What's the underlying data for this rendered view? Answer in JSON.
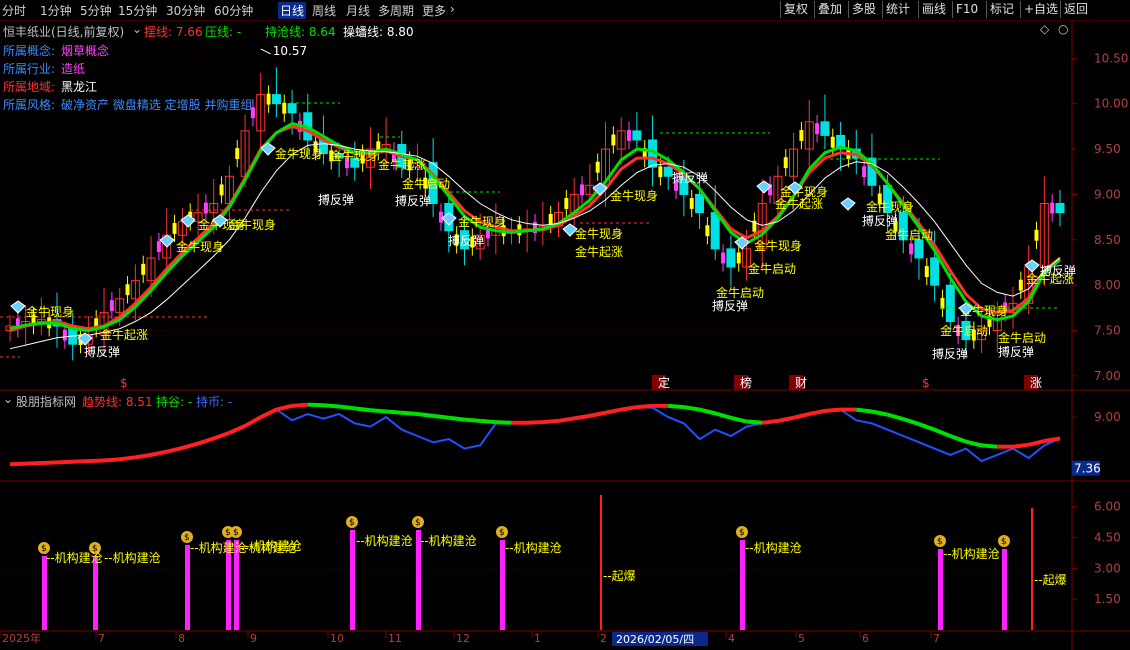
{
  "toolbar": {
    "periods": [
      "分时",
      "1分钟",
      "5分钟",
      "15分钟",
      "30分钟",
      "60分钟",
      "日线",
      "周线",
      "月线",
      "多周期",
      "更多"
    ],
    "active_period": "日线",
    "right_buttons": [
      "复权",
      "叠加",
      "多股",
      "统计",
      "画线",
      "F10",
      "标记",
      "+自选",
      "返回"
    ]
  },
  "main_panel": {
    "stock_title": "恒丰纸业(日线,前复权)",
    "ind_legend": [
      {
        "label": "摆线: 7.66",
        "color": "#ff3030"
      },
      {
        "label": "压线: -",
        "color": "#00e000"
      },
      {
        "label": "持沧线: 8.64",
        "color": "#00e000"
      },
      {
        "label": "操蟠线: 8.80",
        "color": "#ffffff"
      }
    ],
    "info": [
      {
        "key": "所属概念:",
        "value": "烟草概念",
        "key_color": "#3a8aff",
        "value_color": "#ff40ff"
      },
      {
        "key": "所属行业:",
        "value": "造纸",
        "key_color": "#3a8aff",
        "value_color": "#ff40ff"
      },
      {
        "key": "所属地域:",
        "value": "黑龙江",
        "key_color": "#ff3030",
        "value_color": "#ffffff"
      },
      {
        "key": "所属风格:",
        "value": "破净资产 微盘精选 定增股 并购重组",
        "key_color": "#3a8aff",
        "value_color": "#3a8aff"
      }
    ],
    "high_label": "10.57",
    "markers": [
      "$",
      "定",
      "榜",
      "财",
      "$",
      "涨"
    ],
    "signal_labels": [
      "金牛现身",
      "金牛起涨",
      "搏反弹",
      "金牛现身",
      "金牛现身",
      "金牛现身",
      "金牛现身",
      "金牛现身",
      "搏反弹",
      "金牛起涨",
      "金牛启动",
      "搏反弹",
      "金牛现身",
      "搏反弹",
      "金牛现身",
      "金牛起涨",
      "金牛现身",
      "搏反弹",
      "金牛启动",
      "金牛现身",
      "金牛启动",
      "搏反弹",
      "金牛现身",
      "金牛起涨",
      "金牛现身",
      "金牛启动",
      "搏反弹",
      "金牛启动",
      "搏反弹",
      "金牛现身",
      "金牛启动",
      "搏反弹",
      "金牛起涨",
      "搏反弹"
    ]
  },
  "sub_panel1": {
    "title": "股朋指标网",
    "legend": [
      {
        "label": "趋势线: 8.51",
        "color": "#ff3030"
      },
      {
        "label": "持谷: -",
        "color": "#00e000"
      },
      {
        "label": "持币: -",
        "color": "#3a6aff"
      }
    ],
    "current_value": "7.36"
  },
  "sub_panel2": {
    "labels": [
      "机构建沧",
      "机构建沧",
      "机构建沧",
      "机构建沧",
      "机构建沧",
      "机构建沧",
      "机构建沧",
      "机构建沧",
      "机构建沧",
      "机构建沧",
      "起爆",
      "起爆"
    ]
  },
  "chart_data": [
    {
      "type": "candlestick",
      "title": "恒丰纸业(日线,前复权)",
      "ylim": [
        6.9,
        10.9
      ],
      "yticks": [
        "10.50",
        "10.00",
        "9.50",
        "9.00",
        "8.50",
        "8.00",
        "7.50",
        "7.00"
      ],
      "ytick_values": [
        10.5,
        10.0,
        9.5,
        9.0,
        8.5,
        8.0,
        7.5,
        7.0
      ],
      "close": [
        7.55,
        7.6,
        7.62,
        7.55,
        7.35,
        7.45,
        7.7,
        7.85,
        8.05,
        8.3,
        8.55,
        8.7,
        8.8,
        8.9,
        9.2,
        9.7,
        10.1,
        10.0,
        9.9,
        9.6,
        9.45,
        9.4,
        9.3,
        9.5,
        9.55,
        9.3,
        9.35,
        8.9,
        8.6,
        8.4,
        8.55,
        8.6,
        8.6,
        8.62,
        8.65,
        8.8,
        9.0,
        9.1,
        9.5,
        9.7,
        9.6,
        9.3,
        9.2,
        9.0,
        8.8,
        8.4,
        8.2,
        8.4,
        8.9,
        9.2,
        9.5,
        9.8,
        9.65,
        9.5,
        9.4,
        9.1,
        8.8,
        8.5,
        8.3,
        8.0,
        7.6,
        7.4,
        7.5,
        7.7,
        7.8,
        8.2,
        8.9,
        8.8
      ],
      "series": [
        {
          "name": "摆线",
          "color": "#ff3030",
          "values": [
            7.5,
            7.55,
            7.58,
            7.6,
            7.55,
            7.52,
            7.55,
            7.65,
            7.8,
            7.98,
            8.18,
            8.36,
            8.52,
            8.68,
            8.88,
            9.18,
            9.5,
            9.68,
            9.75,
            9.7,
            9.6,
            9.52,
            9.45,
            9.45,
            9.48,
            9.42,
            9.38,
            9.22,
            9.02,
            8.82,
            8.7,
            8.64,
            8.6,
            8.6,
            8.61,
            8.66,
            8.76,
            8.88,
            9.06,
            9.28,
            9.4,
            9.4,
            9.34,
            9.22,
            9.06,
            8.84,
            8.62,
            8.52,
            8.6,
            8.76,
            8.98,
            9.24,
            9.4,
            9.46,
            9.44,
            9.32,
            9.12,
            8.9,
            8.68,
            8.44,
            8.16,
            7.9,
            7.74,
            7.7,
            7.72,
            7.86,
            8.16,
            8.3
          ]
        },
        {
          "name": "持沧线",
          "color": "#00e000",
          "values": [
            7.52,
            7.56,
            7.58,
            7.58,
            7.52,
            7.5,
            7.54,
            7.62,
            7.76,
            7.94,
            8.14,
            8.32,
            8.48,
            8.64,
            8.86,
            9.16,
            9.48,
            9.68,
            9.78,
            9.74,
            9.64,
            9.54,
            9.46,
            9.46,
            9.5,
            9.44,
            9.38,
            9.2,
            8.98,
            8.76,
            8.64,
            8.6,
            8.58,
            8.6,
            8.62,
            8.68,
            8.8,
            8.94,
            9.14,
            9.38,
            9.5,
            9.48,
            9.38,
            9.24,
            9.06,
            8.82,
            8.58,
            8.46,
            8.56,
            8.74,
            8.98,
            9.28,
            9.46,
            9.52,
            9.48,
            9.34,
            9.12,
            8.88,
            8.64,
            8.38,
            8.08,
            7.82,
            7.66,
            7.62,
            7.66,
            7.82,
            8.14,
            8.28
          ]
        },
        {
          "name": "操蟠线",
          "color": "#ffffff",
          "values": [
            7.3,
            7.34,
            7.38,
            7.42,
            7.44,
            7.45,
            7.48,
            7.52,
            7.6,
            7.7,
            7.84,
            8.0,
            8.16,
            8.32,
            8.5,
            8.74,
            9.02,
            9.26,
            9.44,
            9.54,
            9.56,
            9.54,
            9.5,
            9.48,
            9.47,
            9.45,
            9.42,
            9.34,
            9.2,
            9.04,
            8.9,
            8.8,
            8.72,
            8.68,
            8.66,
            8.68,
            8.74,
            8.82,
            8.94,
            9.1,
            9.24,
            9.32,
            9.34,
            9.3,
            9.2,
            9.04,
            8.86,
            8.72,
            8.66,
            8.7,
            8.82,
            9.0,
            9.18,
            9.3,
            9.36,
            9.34,
            9.24,
            9.08,
            8.9,
            8.7,
            8.46,
            8.22,
            8.02,
            7.92,
            7.88,
            7.96,
            8.16,
            8.3
          ]
        }
      ]
    },
    {
      "type": "line",
      "title": "股朋指标网",
      "ylim": [
        7.0,
        9.8
      ],
      "yticks": [
        "9.00",
        "7.36"
      ],
      "ytick_values": [
        9.0,
        7.36
      ],
      "series": [
        {
          "name": "趋势线",
          "color": "#ff3030",
          "values": [
            7.5,
            7.52,
            7.54,
            7.56,
            7.58,
            7.6,
            7.62,
            7.66,
            7.72,
            7.8,
            7.9,
            8.02,
            8.16,
            8.32,
            8.5,
            8.72,
            9.0,
            9.24,
            9.36,
            9.4,
            9.38,
            9.34,
            9.28,
            9.22,
            9.18,
            9.14,
            9.1,
            9.04,
            8.98,
            8.92,
            8.88,
            8.84,
            8.82,
            8.82,
            8.84,
            8.88,
            8.96,
            9.04,
            9.14,
            9.24,
            9.32,
            9.36,
            9.36,
            9.32,
            9.24,
            9.12,
            8.98,
            8.86,
            8.82,
            8.88,
            8.98,
            9.1,
            9.2,
            9.24,
            9.24,
            9.18,
            9.08,
            8.94,
            8.78,
            8.6,
            8.4,
            8.22,
            8.1,
            8.06,
            8.06,
            8.12,
            8.24,
            8.32
          ]
        },
        {
          "name": "持币",
          "color": "#3a6aff",
          "values": [
            7.5,
            7.52,
            7.54,
            7.56,
            7.58,
            7.6,
            7.62,
            7.66,
            7.72,
            7.8,
            7.9,
            8.02,
            8.16,
            8.32,
            8.5,
            8.72,
            9.0,
            9.24,
            8.9,
            9.1,
            8.95,
            9.1,
            8.8,
            8.7,
            9.0,
            8.6,
            8.4,
            8.2,
            8.3,
            8.0,
            8.1,
            8.8,
            8.82,
            8.82,
            8.84,
            8.88,
            8.96,
            9.04,
            9.14,
            9.24,
            9.32,
            9.3,
            9.0,
            8.8,
            8.3,
            8.6,
            8.4,
            8.7,
            8.82,
            8.88,
            8.98,
            9.1,
            9.2,
            9.24,
            8.9,
            8.8,
            8.6,
            8.4,
            8.2,
            8.0,
            7.8,
            8.0,
            7.6,
            7.8,
            8.0,
            7.7,
            8.1,
            8.32
          ]
        }
      ]
    },
    {
      "type": "bar",
      "title": "机构建沧",
      "ylim": [
        0,
        7.2
      ],
      "yticks": [
        "6.00",
        "4.50",
        "3.00",
        "1.50"
      ],
      "ytick_values": [
        6.0,
        4.5,
        3.0,
        1.5
      ],
      "x": [
        "2025年",
        "7",
        "8",
        "9",
        "10",
        "11",
        "12",
        "1",
        "2",
        "3",
        "4",
        "5",
        "6",
        "7"
      ],
      "highlight_date": "2026/02/05/四"
    }
  ]
}
